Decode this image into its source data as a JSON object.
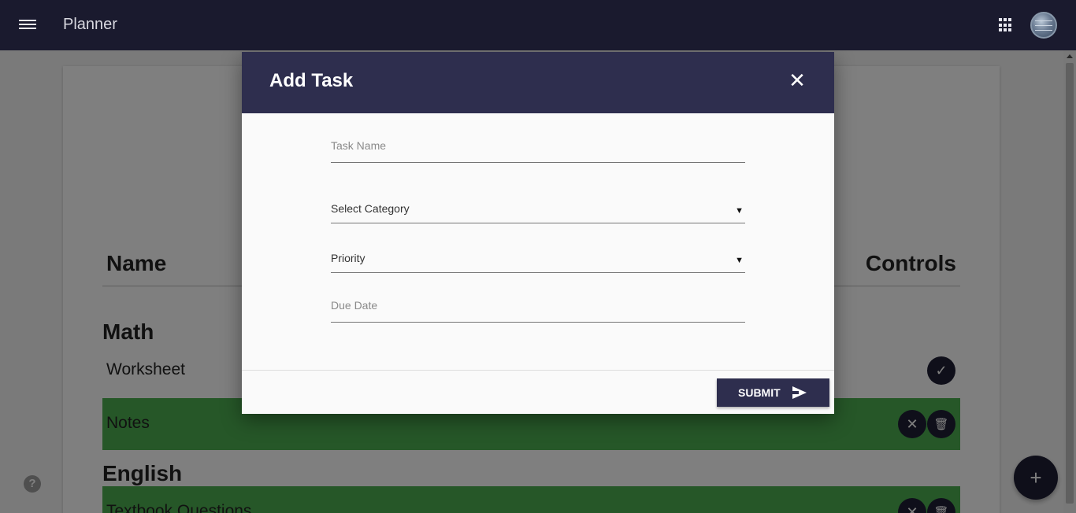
{
  "app": {
    "title": "Planner"
  },
  "table": {
    "name_header": "Name",
    "controls_header": "Controls"
  },
  "categories": [
    {
      "title": "Math",
      "tasks": [
        {
          "name": "Worksheet",
          "done": false
        },
        {
          "name": "Notes",
          "done": true
        }
      ]
    },
    {
      "title": "English",
      "tasks": [
        {
          "name": "Textbook Questions",
          "done": true
        }
      ]
    }
  ],
  "icons": {
    "menu": "menu-icon",
    "apps": "apps-grid-icon",
    "close": "close-icon",
    "send": "send-icon",
    "check": "check-icon",
    "trash": "trash-icon",
    "help": "help-icon",
    "add": "add-icon"
  },
  "glyphs": {
    "close": "✕",
    "check": "✓",
    "undo": "✕",
    "trash": "🗑",
    "help": "?",
    "add": "+"
  },
  "modal": {
    "title": "Add Task",
    "task_name_placeholder": "Task Name",
    "category_label": "Select Category",
    "priority_label": "Priority",
    "due_date_placeholder": "Due Date",
    "submit_label": "SUBMIT",
    "select_arrow": "▼"
  },
  "colors": {
    "topbar": "#1a1a2e",
    "accent": "#2e2e4e",
    "done_row": "#4caf50"
  }
}
